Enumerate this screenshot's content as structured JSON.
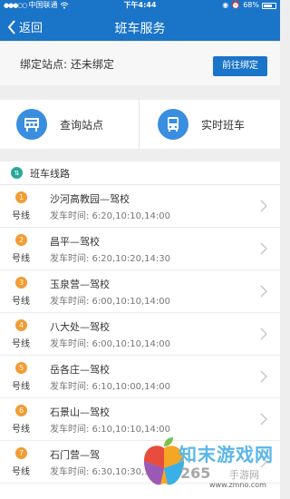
{
  "status_bar": {
    "carrier": "中国联通",
    "time": "下午4:44",
    "battery": "68%"
  },
  "nav": {
    "back_label": "返回",
    "title": "班车服务"
  },
  "binding": {
    "label": "绑定站点: 还未绑定",
    "button_label": "前往绑定"
  },
  "quick_actions": [
    {
      "label": "查询站点",
      "icon": "station-board-icon"
    },
    {
      "label": "实时班车",
      "icon": "bus-icon"
    }
  ],
  "lines_section": {
    "title": "班车线路",
    "icon": "route-icon"
  },
  "routes": [
    {
      "num": "1",
      "suffix": "号线",
      "name": "沙河高教园—驾校",
      "depart": "发车时间: 6:20,10:10,14:00"
    },
    {
      "num": "2",
      "suffix": "号线",
      "name": "昌平—驾校",
      "depart": "发车时间: 6:20,10:20,14:30"
    },
    {
      "num": "3",
      "suffix": "号线",
      "name": "玉泉营—驾校",
      "depart": "发车时间: 6:00,10:10,14:00"
    },
    {
      "num": "4",
      "suffix": "号线",
      "name": "八大处—驾校",
      "depart": "发车时间: 6:00,10:10,14:00"
    },
    {
      "num": "5",
      "suffix": "号线",
      "name": "岳各庄—驾校",
      "depart": "发车时间: 6:10,10:00,14:00"
    },
    {
      "num": "6",
      "suffix": "号线",
      "name": "石景山—驾校",
      "depart": "发车时间: 6:10,10:10,14:00"
    },
    {
      "num": "7",
      "suffix": "号线",
      "name": "石门营—驾",
      "depart": "发车时间: 6:30,10:30,14:00"
    }
  ],
  "watermark": {
    "title": "知末游戏网",
    "number": "265",
    "sub": "手游网",
    "url": "www.zmno.com"
  },
  "colors": {
    "header": "#1a74c8",
    "route_number": "#f39c33"
  }
}
